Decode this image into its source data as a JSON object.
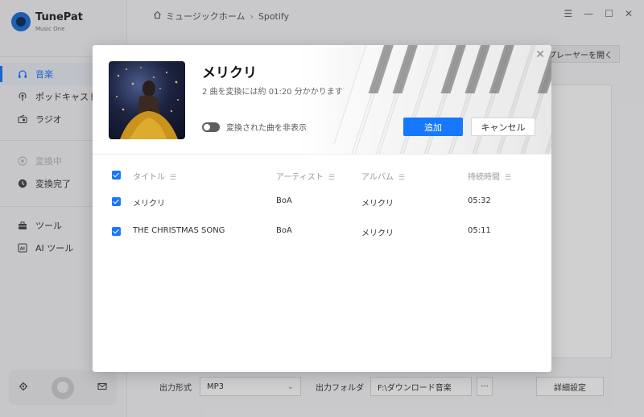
{
  "brand": {
    "name": "TunePat",
    "subtitle": "Music One"
  },
  "sidebar": {
    "items": [
      {
        "label": "音楽",
        "icon": "headphones-icon",
        "state": "active"
      },
      {
        "label": "ポッドキャスト",
        "icon": "podcast-icon",
        "state": "normal"
      },
      {
        "label": "ラジオ",
        "icon": "radio-icon",
        "state": "normal"
      },
      {
        "label": "変換中",
        "icon": "converting-icon",
        "state": "disabled"
      },
      {
        "label": "変換完了",
        "icon": "clock-icon",
        "state": "normal"
      },
      {
        "label": "ツール",
        "icon": "toolbox-icon",
        "state": "normal"
      },
      {
        "label": "AI ツール",
        "icon": "ai-icon",
        "state": "normal"
      }
    ]
  },
  "header": {
    "breadcrumb_home": "ミュージックホーム",
    "breadcrumb_current": "Spotify",
    "player_button": "プレーヤーを開く"
  },
  "bottom_bar": {
    "format_label": "出力形式",
    "format_value": "MP3",
    "folder_label": "出力フォルダ",
    "folder_value": "F:\\ダウンロード音楽",
    "more": "···",
    "settings_button": "詳細設定"
  },
  "modal": {
    "title": "メリクリ",
    "subtitle": "2 曲を変換には約 01:20 分かかります",
    "toggle_label": "変換された曲を非表示",
    "add_button": "追加",
    "cancel_button": "キャンセル",
    "columns": {
      "title": "タイトル",
      "artist": "アーティスト",
      "album": "アルバム",
      "duration": "持続時間"
    },
    "tracks": [
      {
        "title": "メリクリ",
        "artist": "BoA",
        "album": "メリクリ",
        "duration": "05:32"
      },
      {
        "title": "THE CHRISTMAS SONG",
        "artist": "BoA",
        "album": "メリクリ",
        "duration": "05:11"
      }
    ]
  },
  "colors": {
    "accent": "#1677ff",
    "toggle_off": "#5e5e62"
  }
}
